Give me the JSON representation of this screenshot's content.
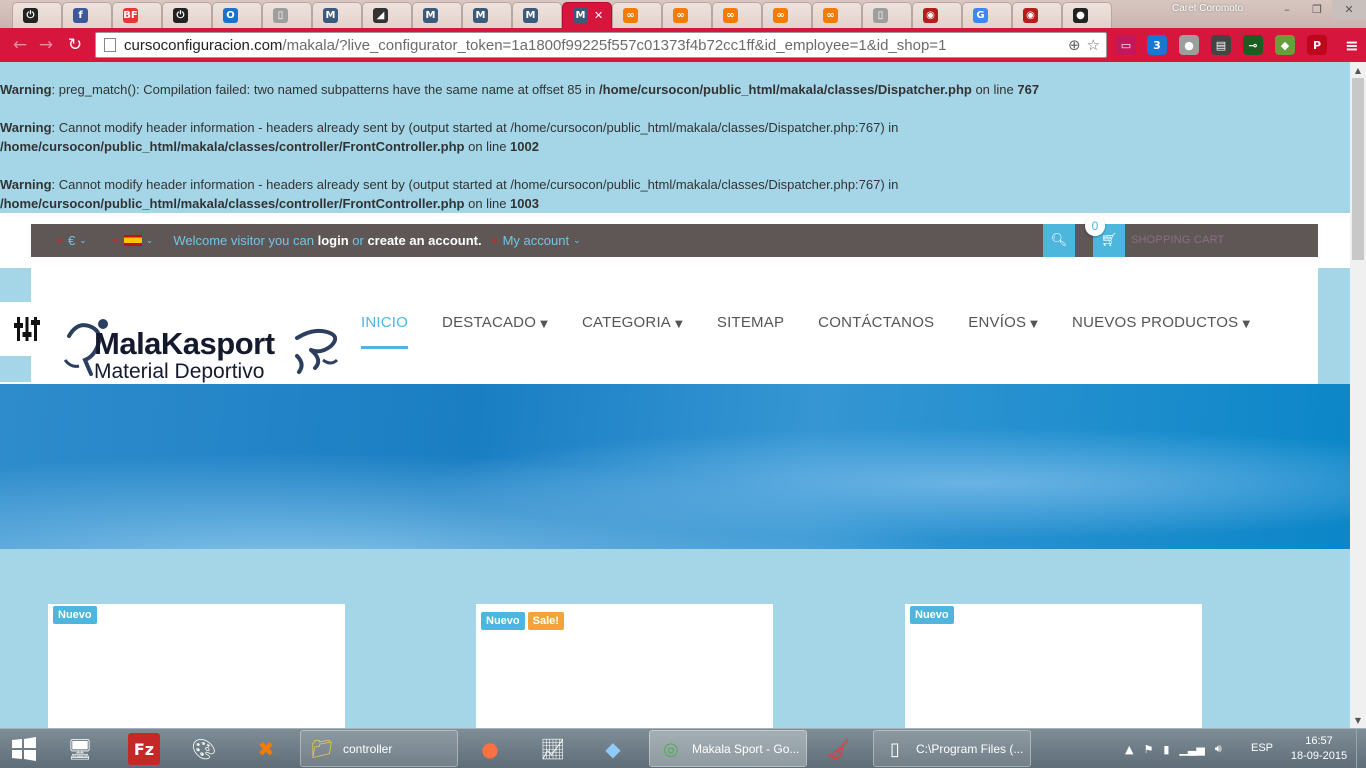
{
  "browser": {
    "tabs": [
      {
        "icon": "power-icon",
        "glyph": "⏻",
        "color": "#222222"
      },
      {
        "icon": "facebook-icon",
        "glyph": "f",
        "color": "#3b5998"
      },
      {
        "icon": "bf-icon",
        "glyph": "BF",
        "color": "#e53935"
      },
      {
        "icon": "power-icon",
        "glyph": "⏻",
        "color": "#222222"
      },
      {
        "icon": "outlook-icon",
        "glyph": "O",
        "color": "#1a73c8"
      },
      {
        "icon": "document-icon",
        "glyph": "▯",
        "color": "#9e9e9e"
      },
      {
        "icon": "makala-icon",
        "glyph": "M",
        "color": "#3c5a7a"
      },
      {
        "icon": "arrow-icon",
        "glyph": "◢",
        "color": "#333333"
      },
      {
        "icon": "makala-icon",
        "glyph": "M",
        "color": "#3c5a7a"
      },
      {
        "icon": "makala-icon",
        "glyph": "M",
        "color": "#3c5a7a"
      },
      {
        "icon": "makala-icon",
        "glyph": "M",
        "color": "#3c5a7a"
      },
      {
        "icon": "makala-icon",
        "glyph": "M",
        "color": "#3c5a7a",
        "active": true
      },
      {
        "icon": "link-icon",
        "glyph": "∞",
        "color": "#f57c00"
      },
      {
        "icon": "link-icon",
        "glyph": "∞",
        "color": "#f57c00"
      },
      {
        "icon": "link-icon",
        "glyph": "∞",
        "color": "#f57c00"
      },
      {
        "icon": "link-icon",
        "glyph": "∞",
        "color": "#f57c00"
      },
      {
        "icon": "link-icon",
        "glyph": "∞",
        "color": "#f57c00"
      },
      {
        "icon": "document-icon",
        "glyph": "▯",
        "color": "#9e9e9e"
      },
      {
        "icon": "eye-icon",
        "glyph": "◉",
        "color": "#b71c1c"
      },
      {
        "icon": "google-icon",
        "glyph": "G",
        "color": "#4285f4"
      },
      {
        "icon": "eye-icon",
        "glyph": "◉",
        "color": "#b71c1c"
      },
      {
        "icon": "reddit-icon",
        "glyph": "●",
        "color": "#222222"
      }
    ],
    "profile_name": "Caret Coromoto",
    "url_host": "cursoconfiguracion.com",
    "url_path": "/makala/?live_configurator_token=1a1800f99225f557c01373f4b72cc1ff&id_employee=1&id_shop=1",
    "toolbar_extensions": [
      {
        "name": "cast-icon",
        "glyph": "▭",
        "color": "#c2185b"
      },
      {
        "name": "css3-icon",
        "glyph": "3",
        "color": "#1976d2"
      },
      {
        "name": "avatar-icon",
        "glyph": "●",
        "color": "#9e9e9e"
      },
      {
        "name": "printer-icon",
        "glyph": "▤",
        "color": "#444444"
      },
      {
        "name": "key-icon",
        "glyph": "⊸",
        "color": "#1b5e20"
      },
      {
        "name": "diamond-icon",
        "glyph": "◆",
        "color": "#689f38"
      },
      {
        "name": "pinterest-icon",
        "glyph": "P",
        "color": "#bd081c"
      },
      {
        "name": "menu-icon",
        "glyph": "≡",
        "color": "#d6163d"
      }
    ]
  },
  "warnings": [
    {
      "label": "Warning",
      "text": ": preg_match(): Compilation failed: two named subpatterns have the same name at offset 85 in ",
      "file": "/home/cursocon/public_html/makala/classes/Dispatcher.php",
      "on": " on line ",
      "line": "767"
    },
    {
      "label": "Warning",
      "text": ": Cannot modify header information - headers already sent by (output started at /home/cursocon/public_html/makala/classes/Dispatcher.php:767) in ",
      "file": "/home/cursocon/public_html/makala/classes/controller/FrontController.php",
      "on": " on line ",
      "line": "1002"
    },
    {
      "label": "Warning",
      "text": ": Cannot modify header information - headers already sent by (output started at /home/cursocon/public_html/makala/classes/Dispatcher.php:767) in ",
      "file": "/home/cursocon/public_html/makala/classes/controller/FrontController.php",
      "on": " on line ",
      "line": "1003"
    }
  ],
  "shop": {
    "currency": "€",
    "welcome_prefix": "Welcome visitor you can ",
    "login": "login",
    "or": " or ",
    "create_account": "create an account.",
    "my_account": "My account",
    "cart_count": "0",
    "cart_label": "SHOPPING CART",
    "logo_brand": "MalaKasport",
    "logo_tagline": "Material Deportivo",
    "nav": [
      {
        "label": "INICIO",
        "active": true,
        "dropdown": false
      },
      {
        "label": "DESTACADO",
        "active": false,
        "dropdown": true
      },
      {
        "label": "CATEGORIA",
        "active": false,
        "dropdown": true
      },
      {
        "label": "SITEMAP",
        "active": false,
        "dropdown": false
      },
      {
        "label": "CONTÁCTANOS",
        "active": false,
        "dropdown": false
      },
      {
        "label": "ENVÍOS",
        "active": false,
        "dropdown": true
      },
      {
        "label": "NUEVOS PRODUCTOS",
        "active": false,
        "dropdown": true
      }
    ],
    "products": [
      {
        "badges": [
          "Nuevo"
        ]
      },
      {
        "badges": [
          "Nuevo",
          "Sale!"
        ]
      },
      {
        "badges": [
          "Nuevo"
        ]
      }
    ]
  },
  "taskbar": {
    "tasks": [
      {
        "label": "controller",
        "icon": "folder-icon"
      },
      {
        "label": "Makala Sport - Go...",
        "icon": "chrome-icon",
        "active": true
      },
      {
        "label": "C:\\Program Files (...",
        "icon": "notepad-icon"
      }
    ],
    "language": "ESP",
    "time": "16:57",
    "date": "18-09-2015"
  },
  "colors": {
    "chrome_accent": "#d6163d",
    "page_bg": "#a4d6e8",
    "shop_accent": "#4db6dd",
    "topbar_bg": "#5e5755",
    "sale_badge": "#f0a43a"
  }
}
